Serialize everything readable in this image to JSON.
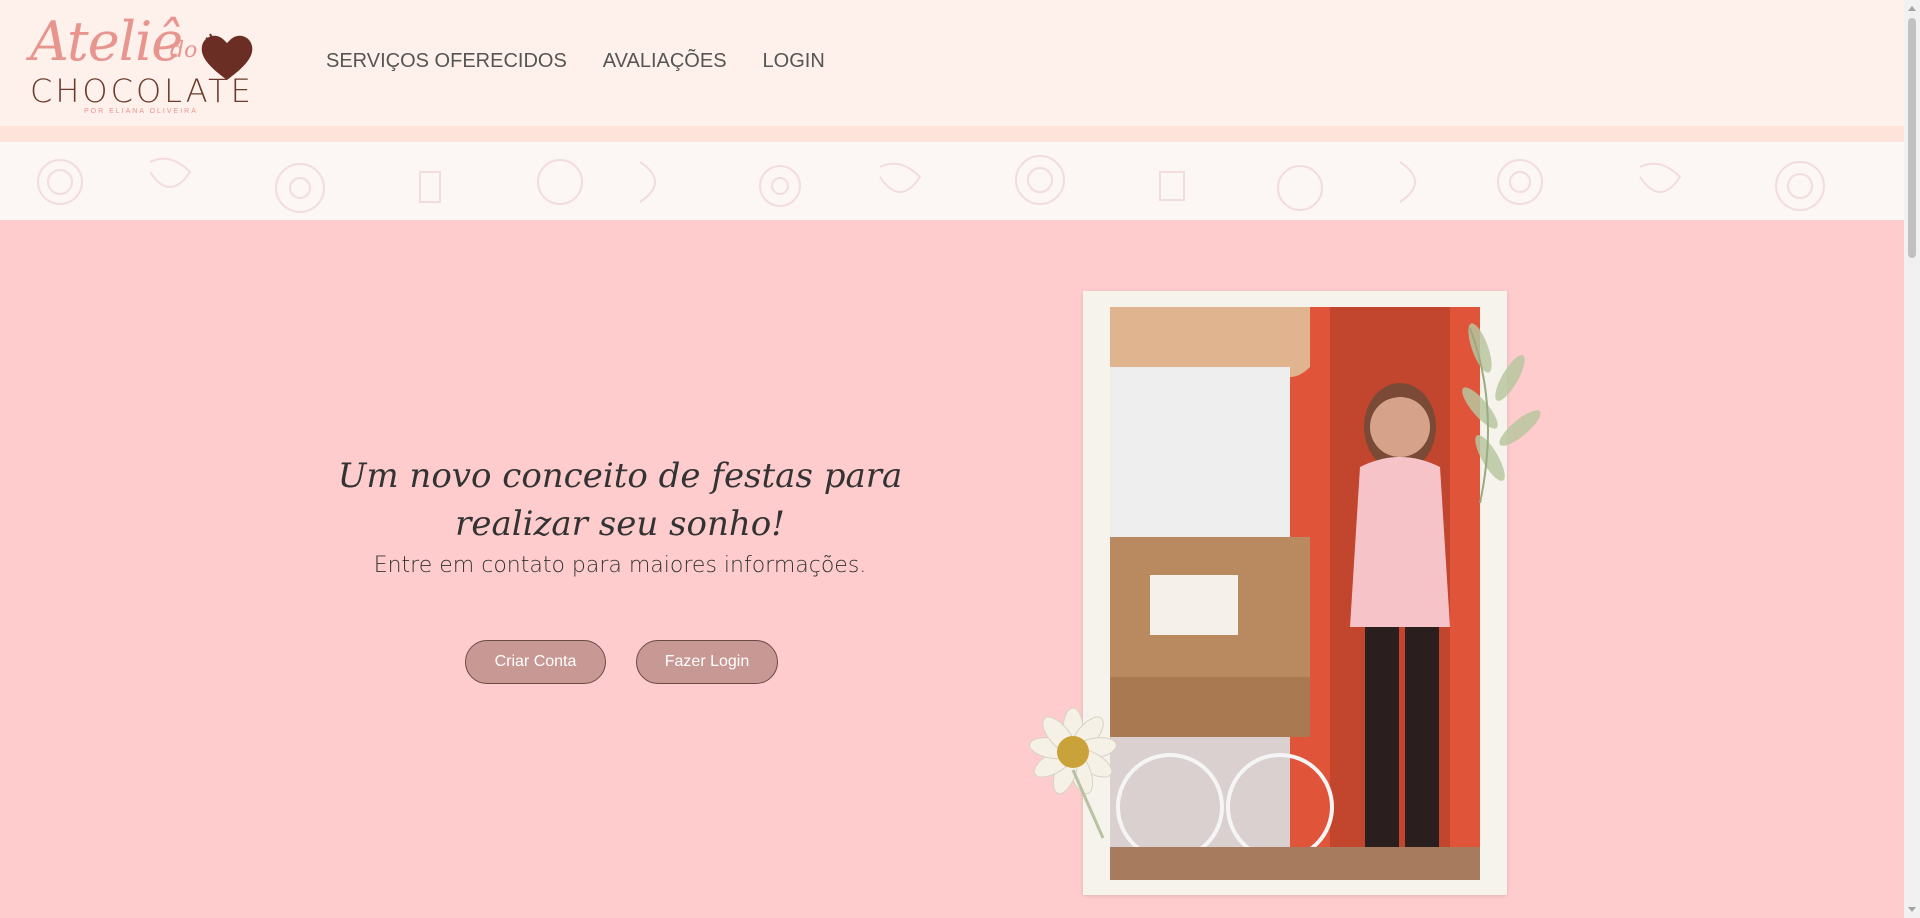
{
  "logo": {
    "script": "Ateliê",
    "do": "do",
    "main": "CHOCOLATE",
    "sub": "POR ELIANA OLIVEIRA"
  },
  "nav": {
    "items": [
      "SERVIÇOS OFERECIDOS",
      "AVALIAÇÕES",
      "LOGIN"
    ]
  },
  "hero": {
    "title": "Um novo conceito de festas para realizar seu sonho!",
    "subtitle": "Entre em contato para maiores informações.",
    "buttons": {
      "create": "Criar Conta",
      "login": "Fazer Login"
    }
  },
  "colors": {
    "header_bg": "#fef0ea",
    "hero_bg": "#ffcccd",
    "button_bg": "#c79894",
    "logo_pink": "#e8958f",
    "logo_brown": "#6b3a2b"
  },
  "icons": [
    "heart-logo-icon",
    "daisy-decoration",
    "leaves-decoration"
  ]
}
